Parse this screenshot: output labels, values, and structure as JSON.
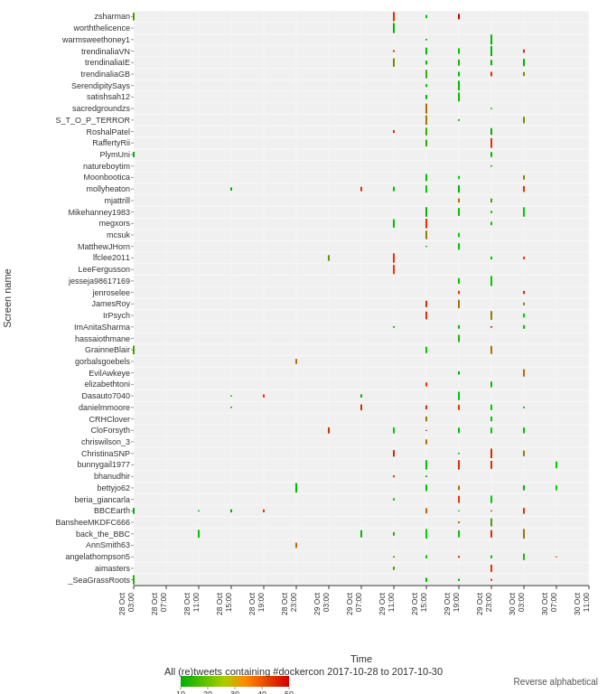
{
  "chart": {
    "title": "All (re)tweets containing #dockercon 2017-10-28 to 2017-10-30",
    "subtitle": "Reverse alphabetical",
    "xaxis_label": "Time",
    "yaxis_label": "Screen name",
    "legend_min": 10,
    "legend_max": 50,
    "legend_steps": [
      10,
      20,
      30,
      40,
      50
    ],
    "screen_names": [
      "zsharman",
      "worththelicence",
      "warmsweethoney1",
      "trendinaliaVN",
      "trendinaliaIE",
      "trendinaliaGB",
      "SerendipitySays",
      "satishsah12",
      "sacredgroundzs",
      "S_T_O_P_TERROR",
      "RoshalPatel",
      "RaffertyRii",
      "PlymUni",
      "natureboytim",
      "Moonbootica",
      "mollyheaton",
      "mjattrill",
      "Mikehanney1983",
      "megxors",
      "mcsuk",
      "MatthewJHorn",
      "lfclee2011",
      "LeeFergusson",
      "jesseja98617169",
      "jenroselee",
      "JamesRoy",
      "IrPsych",
      "ImAnitaSharma",
      "hassaiothmane",
      "GrainneBlair",
      "gorbalsgoebels",
      "EvilAwkeye",
      "elizabethtoni",
      "Dasauto7040",
      "danielmmoore",
      "CRHClover",
      "CloForsyth",
      "chriswilson_3",
      "ChristinaSNP",
      "bunnygail1977",
      "bhanudhir",
      "bettyjo62",
      "beria_giancarla",
      "BBCEarth",
      "BansheeMKDFC666",
      "back_the_BBC",
      "AnnSmith63",
      "angelathompson5",
      "aimasters",
      "_SeaGrassRoots"
    ],
    "x_ticks": [
      "28 Oct 03:00",
      "28 Oct 07:00",
      "28 Oct 11:00",
      "28 Oct 15:00",
      "28 Oct 19:00",
      "28 Oct 23:00",
      "29 Oct 03:00",
      "29 Oct 07:00",
      "29 Oct 11:00",
      "29 Oct 15:00",
      "29 Oct 19:00",
      "29 Oct 23:00",
      "30 Oct 03:00",
      "30 Oct 07:00",
      "30 Oct 11:00"
    ]
  }
}
